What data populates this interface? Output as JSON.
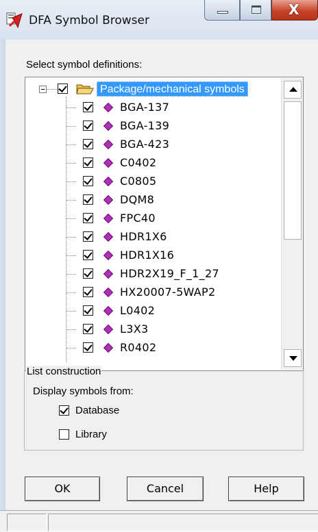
{
  "window": {
    "title": "DFA Symbol Browser",
    "colors": {
      "selection": "#3399ff",
      "symbol_icon": "#b030b8",
      "close_button": "#c8432b"
    }
  },
  "select_label": "Select symbol definitions:",
  "tree": {
    "root": {
      "label": "Package/mechanical symbols",
      "checked": true,
      "expanded": true,
      "icon": "folder-open-icon"
    },
    "items": [
      {
        "label": "BGA-137",
        "checked": true
      },
      {
        "label": "BGA-139",
        "checked": true
      },
      {
        "label": "BGA-423",
        "checked": true
      },
      {
        "label": "C0402",
        "checked": true
      },
      {
        "label": "C0805",
        "checked": true
      },
      {
        "label": "DQM8",
        "checked": true
      },
      {
        "label": "FPC40",
        "checked": true
      },
      {
        "label": "HDR1X6",
        "checked": true
      },
      {
        "label": "HDR1X16",
        "checked": true
      },
      {
        "label": "HDR2X19_F_1_27",
        "checked": true
      },
      {
        "label": "HX20007-5WAP2",
        "checked": true
      },
      {
        "label": "L0402",
        "checked": true
      },
      {
        "label": "L3X3",
        "checked": true
      },
      {
        "label": "R0402",
        "checked": true
      }
    ]
  },
  "list_construction": {
    "title": "List construction",
    "display_label": "Display symbols from:",
    "options": [
      {
        "label": "Database",
        "checked": true
      },
      {
        "label": "Library",
        "checked": false
      }
    ]
  },
  "buttons": {
    "ok": "OK",
    "cancel": "Cancel",
    "help": "Help"
  }
}
